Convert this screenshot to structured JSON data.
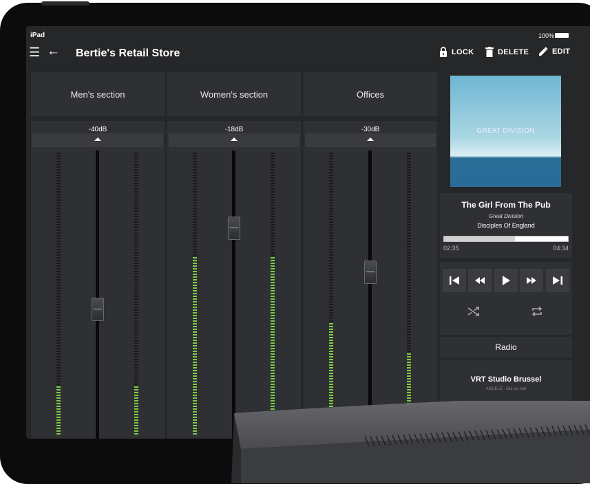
{
  "status_bar": {
    "device": "iPad",
    "battery": "100%"
  },
  "app_bar": {
    "title": "Bertie's Retail Store",
    "actions": [
      {
        "label": "LOCK",
        "icon": "lock-icon"
      },
      {
        "label": "DELETE",
        "icon": "trash-icon"
      },
      {
        "label": "EDIT",
        "icon": "pencil-icon"
      }
    ]
  },
  "zones": [
    {
      "name": "Men's section",
      "level": "-40dB"
    },
    {
      "name": "Women's section",
      "level": "-18dB"
    },
    {
      "name": "Offices",
      "level": "-30dB"
    }
  ],
  "now_playing": {
    "album_art_text": "GREAT DIVISION",
    "title": "The Girl From The Pub",
    "artist": "Great Division",
    "album": "Disciples Of England",
    "elapsed": "02:35",
    "duration": "04:34",
    "progress": 0.57
  },
  "controls": {
    "icons": [
      "skip-previous-icon",
      "rewind-icon",
      "play-icon",
      "fast-forward-icon",
      "skip-next-icon",
      "shuffle-icon",
      "repeat-icon"
    ]
  },
  "source": {
    "label": "Radio"
  },
  "station": {
    "name": "VRT Studio Brussel",
    "now": "ANGELE - Oui ou non"
  },
  "colors": {
    "background": "#262729",
    "panel": "#2f3033",
    "meter_active": "#7ccd45",
    "meter_idle": "#1a1a1a"
  }
}
